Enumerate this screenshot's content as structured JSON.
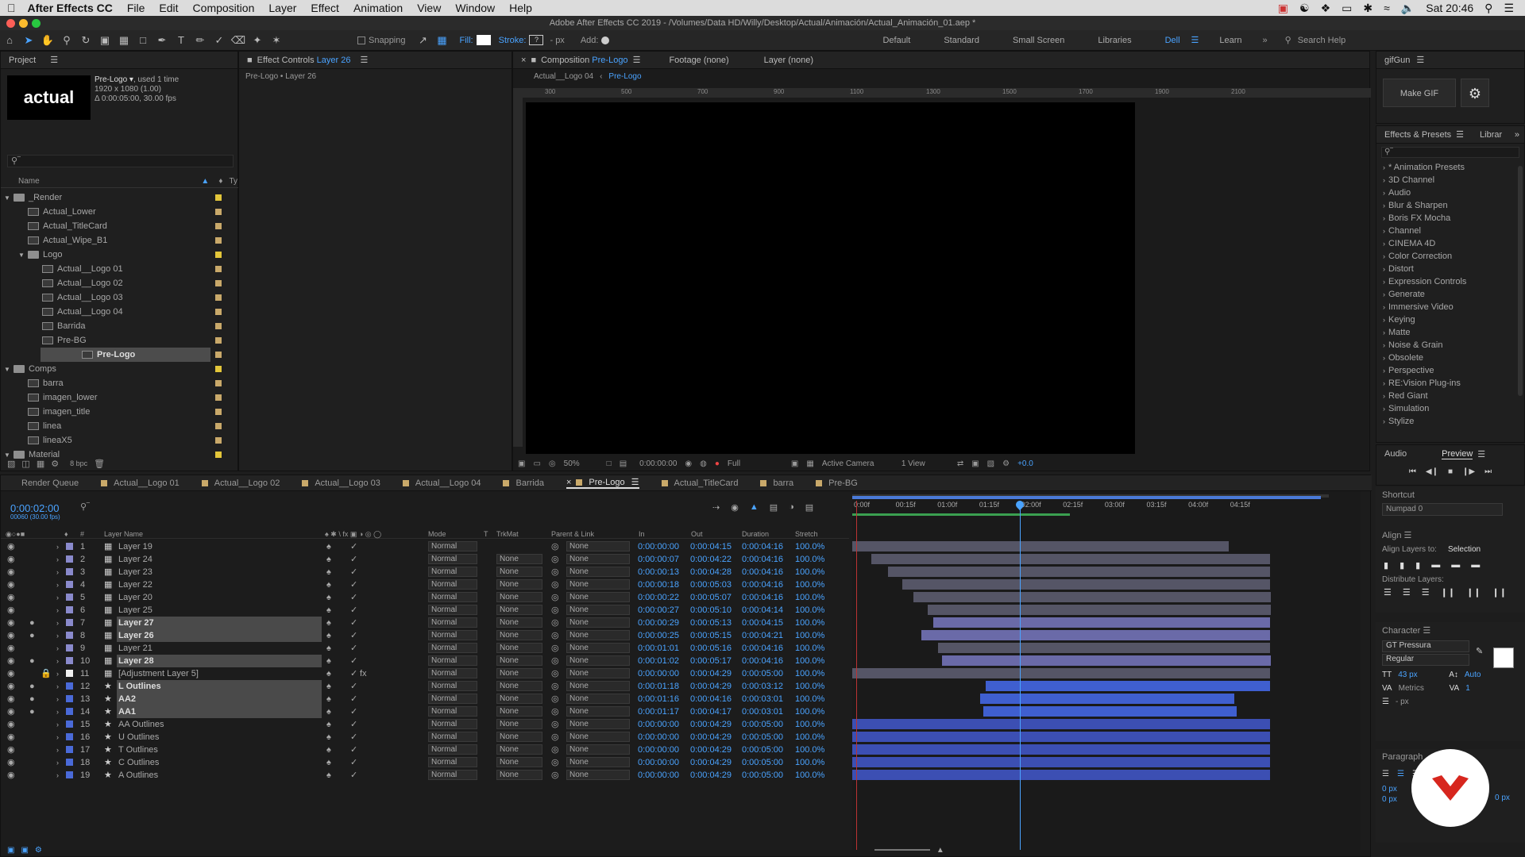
{
  "menubar": {
    "app": "After Effects CC",
    "items": [
      "File",
      "Edit",
      "Composition",
      "Layer",
      "Effect",
      "Animation",
      "View",
      "Window",
      "Help"
    ],
    "clock": "Sat 20:46"
  },
  "titlebar": {
    "title": "Adobe After Effects CC 2019 - /Volumes/Data HD/Willy/Desktop/Actual/Animación/Actual_Animación_01.aep *"
  },
  "toolbar": {
    "snapping": "Snapping",
    "fill": "Fill:",
    "stroke": "Stroke:",
    "px": "- px",
    "add": "Add:",
    "workspaces": [
      "Default",
      "Standard",
      "Small Screen",
      "Libraries",
      "Dell",
      "Learn"
    ],
    "active_workspace": "Dell",
    "search": "Search Help"
  },
  "project": {
    "tab": "Project",
    "item_name": "Pre-Logo ▾",
    "used": ", used 1 time",
    "info1": "1920 x 1080 (1.00)",
    "info2": "Δ 0:00:05:00, 30.00 fps",
    "logo": "actual",
    "col_name": "Name",
    "col_type": "Ty",
    "bpc": "8 bpc",
    "tree": [
      {
        "label": "_Render",
        "kind": "folder",
        "depth": 0,
        "color": "#e3c63a"
      },
      {
        "label": "Actual_Lower",
        "kind": "comp",
        "depth": 1,
        "color": "#c9a96a"
      },
      {
        "label": "Actual_TitleCard",
        "kind": "comp",
        "depth": 1,
        "color": "#c9a96a"
      },
      {
        "label": "Actual_Wipe_B1",
        "kind": "comp",
        "depth": 1,
        "color": "#c9a96a"
      },
      {
        "label": "Logo",
        "kind": "folder",
        "depth": 1,
        "color": "#e3c63a"
      },
      {
        "label": "Actual__Logo 01",
        "kind": "comp",
        "depth": 2,
        "color": "#c9a96a"
      },
      {
        "label": "Actual__Logo 02",
        "kind": "comp",
        "depth": 2,
        "color": "#c9a96a"
      },
      {
        "label": "Actual__Logo 03",
        "kind": "comp",
        "depth": 2,
        "color": "#c9a96a"
      },
      {
        "label": "Actual__Logo 04",
        "kind": "comp",
        "depth": 2,
        "color": "#c9a96a"
      },
      {
        "label": "Barrida",
        "kind": "comp",
        "depth": 2,
        "color": "#c9a96a"
      },
      {
        "label": "Pre-BG",
        "kind": "comp",
        "depth": 2,
        "color": "#c9a96a"
      },
      {
        "label": "Pre-Logo",
        "kind": "comp",
        "depth": 2,
        "color": "#c9a96a",
        "selected": true
      },
      {
        "label": "Comps",
        "kind": "folder",
        "depth": 0,
        "color": "#e3c63a"
      },
      {
        "label": "barra",
        "kind": "comp",
        "depth": 1,
        "color": "#c9a96a"
      },
      {
        "label": "imagen_lower",
        "kind": "comp",
        "depth": 1,
        "color": "#c9a96a"
      },
      {
        "label": "imagen_title",
        "kind": "comp",
        "depth": 1,
        "color": "#c9a96a"
      },
      {
        "label": "linea",
        "kind": "comp",
        "depth": 1,
        "color": "#c9a96a"
      },
      {
        "label": "lineaX5",
        "kind": "comp",
        "depth": 1,
        "color": "#c9a96a"
      },
      {
        "label": "Material",
        "kind": "folder",
        "depth": 0,
        "color": "#e3c63a"
      }
    ]
  },
  "effects_controls": {
    "tab": "Effect Controls",
    "layer": "Layer 26",
    "sub": "Pre-Logo • Layer 26"
  },
  "comp_viewer": {
    "tab_prefix": "Composition",
    "tab_name": "Pre-Logo",
    "footage": "Footage (none)",
    "layer": "Layer (none)",
    "crumb1": "Actual__Logo 04",
    "crumb2": "Pre-Logo",
    "ruler_labels": [
      "300",
      "500",
      "700",
      "900",
      "1100",
      "1300",
      "1500",
      "1700",
      "1900",
      "2100"
    ],
    "zoom": "50%",
    "time": "0:00:00:00",
    "resolution": "Full",
    "camera": "Active Camera",
    "views": "1 View",
    "offset": "+0.0"
  },
  "gifgun": {
    "tab": "gifGun",
    "make": "Make GIF"
  },
  "effects_presets": {
    "tab": "Effects & Presets",
    "tab2": "Librar",
    "items": [
      "* Animation Presets",
      "3D Channel",
      "Audio",
      "Blur & Sharpen",
      "Boris FX Mocha",
      "Channel",
      "CINEMA 4D",
      "Color Correction",
      "Distort",
      "Expression Controls",
      "Generate",
      "Immersive Video",
      "Keying",
      "Matte",
      "Noise & Grain",
      "Obsolete",
      "Perspective",
      "RE:Vision Plug-ins",
      "Red Giant",
      "Simulation",
      "Stylize"
    ]
  },
  "preview": {
    "tab1": "Audio",
    "tab2": "Preview"
  },
  "shortcut": {
    "label": "Shortcut",
    "value": "Numpad 0"
  },
  "align": {
    "tab": "Align",
    "to_label": "Align Layers to:",
    "to_value": "Selection",
    "dist": "Distribute Layers:"
  },
  "character": {
    "tab": "Character",
    "font": "GT Pressura",
    "style": "Regular",
    "size": "43 px",
    "tracking_auto": "Auto",
    "metrics": "Metrics",
    "one": "1",
    "px": "- px"
  },
  "paragraph": {
    "tab": "Paragraph",
    "zero1": "0 px",
    "zero2": "0 px",
    "zero3": "0 px"
  },
  "timeline": {
    "tabs": [
      "Render Queue",
      "Actual__Logo 01",
      "Actual__Logo 02",
      "Actual__Logo 03",
      "Actual__Logo 04",
      "Barrida",
      "Pre-Logo",
      "Actual_TitleCard",
      "barra",
      "Pre-BG"
    ],
    "active_tab": "Pre-Logo",
    "timecode": "0:00:02:00",
    "fps": "00060 (30.00 fps)",
    "cols": {
      "num": "#",
      "name": "Layer Name",
      "mode": "Mode",
      "t": "T",
      "trkmat": "TrkMat",
      "parent": "Parent & Link",
      "in": "In",
      "out": "Out",
      "duration": "Duration",
      "stretch": "Stretch"
    },
    "ruler": [
      "0:00f",
      "00:15f",
      "01:00f",
      "01:15f",
      "02:00f",
      "02:15f",
      "03:00f",
      "03:15f",
      "04:00f",
      "04:15f"
    ],
    "playhead_seconds": 2.0,
    "layers": [
      {
        "n": "1",
        "name": "Layer 19",
        "mode": "Normal",
        "trk": "",
        "parent": "None",
        "in": "0:00:00:00",
        "out": "0:00:04:15",
        "dur": "0:00:04:16",
        "str": "100.0%",
        "start": 0.0,
        "end": 4.5,
        "color": "#8a8acc",
        "star": false,
        "sel": false
      },
      {
        "n": "2",
        "name": "Layer 24",
        "mode": "Normal",
        "trk": "None",
        "parent": "None",
        "in": "0:00:00:07",
        "out": "0:00:04:22",
        "dur": "0:00:04:16",
        "str": "100.0%",
        "start": 0.23,
        "end": 5.0,
        "color": "#8a8acc",
        "star": false,
        "sel": false
      },
      {
        "n": "3",
        "name": "Layer 23",
        "mode": "Normal",
        "trk": "None",
        "parent": "None",
        "in": "0:00:00:13",
        "out": "0:00:04:28",
        "dur": "0:00:04:16",
        "str": "100.0%",
        "start": 0.43,
        "end": 5.0,
        "color": "#8a8acc",
        "star": false,
        "sel": false
      },
      {
        "n": "4",
        "name": "Layer 22",
        "mode": "Normal",
        "trk": "None",
        "parent": "None",
        "in": "0:00:00:18",
        "out": "0:00:05:03",
        "dur": "0:00:04:16",
        "str": "100.0%",
        "start": 0.6,
        "end": 5.0,
        "color": "#8a8acc",
        "star": false,
        "sel": false
      },
      {
        "n": "5",
        "name": "Layer 20",
        "mode": "Normal",
        "trk": "None",
        "parent": "None",
        "in": "0:00:00:22",
        "out": "0:00:05:07",
        "dur": "0:00:04:16",
        "str": "100.0%",
        "start": 0.73,
        "end": 5.0,
        "color": "#8a8acc",
        "star": false,
        "sel": false
      },
      {
        "n": "6",
        "name": "Layer 25",
        "mode": "Normal",
        "trk": "None",
        "parent": "None",
        "in": "0:00:00:27",
        "out": "0:00:05:10",
        "dur": "0:00:04:14",
        "str": "100.0%",
        "start": 0.9,
        "end": 5.0,
        "color": "#8a8acc",
        "star": false,
        "sel": false
      },
      {
        "n": "7",
        "name": "Layer 27",
        "mode": "Normal",
        "trk": "None",
        "parent": "None",
        "in": "0:00:00:29",
        "out": "0:00:05:13",
        "dur": "0:00:04:15",
        "str": "100.0%",
        "start": 0.97,
        "end": 5.0,
        "color": "#8a8acc",
        "star": false,
        "sel": true
      },
      {
        "n": "8",
        "name": "Layer 26",
        "mode": "Normal",
        "trk": "None",
        "parent": "None",
        "in": "0:00:00:25",
        "out": "0:00:05:15",
        "dur": "0:00:04:21",
        "str": "100.0%",
        "start": 0.83,
        "end": 5.0,
        "color": "#8a8acc",
        "star": false,
        "sel": true
      },
      {
        "n": "9",
        "name": "Layer 21",
        "mode": "Normal",
        "trk": "None",
        "parent": "None",
        "in": "0:00:01:01",
        "out": "0:00:05:16",
        "dur": "0:00:04:16",
        "str": "100.0%",
        "start": 1.03,
        "end": 5.0,
        "color": "#8a8acc",
        "star": false,
        "sel": false
      },
      {
        "n": "10",
        "name": "Layer 28",
        "mode": "Normal",
        "trk": "None",
        "parent": "None",
        "in": "0:00:01:02",
        "out": "0:00:05:17",
        "dur": "0:00:04:16",
        "str": "100.0%",
        "start": 1.07,
        "end": 5.0,
        "color": "#8a8acc",
        "star": false,
        "sel": true
      },
      {
        "n": "11",
        "name": "[Adjustment Layer 5]",
        "mode": "Normal",
        "trk": "None",
        "parent": "None",
        "in": "0:00:00:00",
        "out": "0:00:04:29",
        "dur": "0:00:05:00",
        "str": "100.0%",
        "start": 0.0,
        "end": 5.0,
        "color": "#f0f0f0",
        "star": false,
        "sel": false
      },
      {
        "n": "12",
        "name": "L Outlines",
        "mode": "Normal",
        "trk": "None",
        "parent": "None",
        "in": "0:00:01:18",
        "out": "0:00:04:29",
        "dur": "0:00:03:12",
        "str": "100.0%",
        "start": 1.6,
        "end": 5.0,
        "color": "#4a6ad8",
        "star": true,
        "sel": true
      },
      {
        "n": "13",
        "name": "AA2",
        "mode": "Normal",
        "trk": "None",
        "parent": "None",
        "in": "0:00:01:16",
        "out": "0:00:04:16",
        "dur": "0:00:03:01",
        "str": "100.0%",
        "start": 1.53,
        "end": 4.57,
        "color": "#4a6ad8",
        "star": true,
        "sel": true
      },
      {
        "n": "14",
        "name": "AA1",
        "mode": "Normal",
        "trk": "None",
        "parent": "None",
        "in": "0:00:01:17",
        "out": "0:00:04:17",
        "dur": "0:00:03:01",
        "str": "100.0%",
        "start": 1.57,
        "end": 4.6,
        "color": "#4a6ad8",
        "star": true,
        "sel": true
      },
      {
        "n": "15",
        "name": "AA Outlines",
        "mode": "Normal",
        "trk": "None",
        "parent": "None",
        "in": "0:00:00:00",
        "out": "0:00:04:29",
        "dur": "0:00:05:00",
        "str": "100.0%",
        "start": 0.0,
        "end": 5.0,
        "color": "#4a6ad8",
        "star": true,
        "sel": false
      },
      {
        "n": "16",
        "name": "U Outlines",
        "mode": "Normal",
        "trk": "None",
        "parent": "None",
        "in": "0:00:00:00",
        "out": "0:00:04:29",
        "dur": "0:00:05:00",
        "str": "100.0%",
        "start": 0.0,
        "end": 5.0,
        "color": "#4a6ad8",
        "star": true,
        "sel": false
      },
      {
        "n": "17",
        "name": "T Outlines",
        "mode": "Normal",
        "trk": "None",
        "parent": "None",
        "in": "0:00:00:00",
        "out": "0:00:04:29",
        "dur": "0:00:05:00",
        "str": "100.0%",
        "start": 0.0,
        "end": 5.0,
        "color": "#4a6ad8",
        "star": true,
        "sel": false
      },
      {
        "n": "18",
        "name": "C Outlines",
        "mode": "Normal",
        "trk": "None",
        "parent": "None",
        "in": "0:00:00:00",
        "out": "0:00:04:29",
        "dur": "0:00:05:00",
        "str": "100.0%",
        "start": 0.0,
        "end": 5.0,
        "color": "#4a6ad8",
        "star": true,
        "sel": false
      },
      {
        "n": "19",
        "name": "A Outlines",
        "mode": "Normal",
        "trk": "None",
        "parent": "None",
        "in": "0:00:00:00",
        "out": "0:00:04:29",
        "dur": "0:00:05:00",
        "str": "100.0%",
        "start": 0.0,
        "end": 5.0,
        "color": "#4a6ad8",
        "star": true,
        "sel": false
      }
    ]
  }
}
